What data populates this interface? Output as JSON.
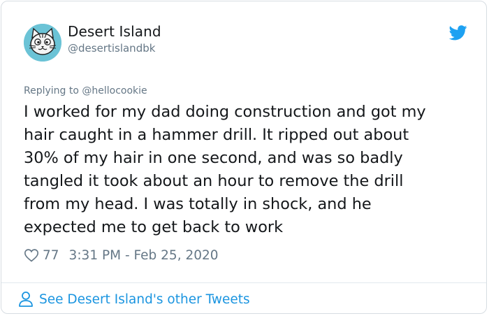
{
  "author": {
    "display_name": "Desert Island",
    "handle": "@desertislandbk"
  },
  "reply": {
    "prefix": "Replying to",
    "mention": "@hellocookie"
  },
  "tweet": {
    "lines": [
      "I worked for my dad doing construction and got my",
      "hair caught in a hammer drill. It ripped out about",
      "30% of my hair in one second, and was so badly",
      "tangled it took about an hour to remove the drill",
      "from my head. I was totally in shock, and he",
      "expected me to get back to work"
    ]
  },
  "meta": {
    "like_count": "77",
    "timestamp": "3:31 PM - Feb 25, 2020"
  },
  "footer": {
    "link_text": "See Desert Island's other Tweets"
  },
  "icons": {
    "bird": "twitter-bird-icon",
    "heart": "heart-icon",
    "person": "person-icon"
  },
  "colors": {
    "accent": "#1b95e0",
    "text_primary": "#14171a",
    "text_secondary": "#657786",
    "avatar_bg": "#6bc3d6"
  }
}
